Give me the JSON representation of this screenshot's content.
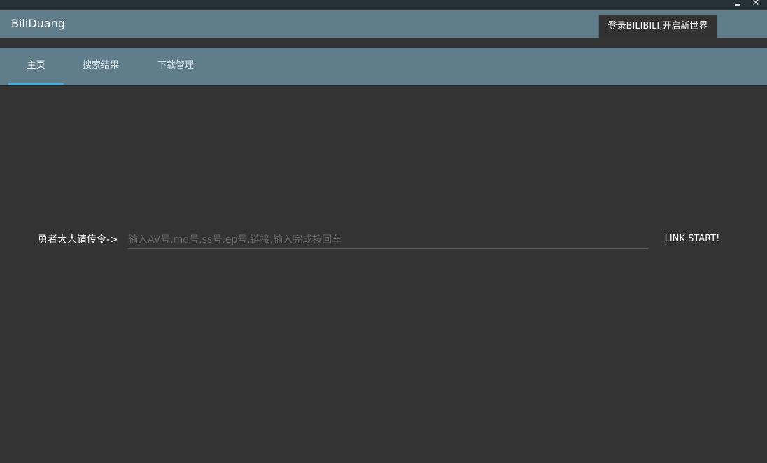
{
  "window": {
    "minimize_label": "",
    "close_label": "✕"
  },
  "app": {
    "title": "BiliDuang",
    "login_button": "登录BILIBILI,开启新世界"
  },
  "tabs": [
    {
      "label": "主页",
      "active": true
    },
    {
      "label": "搜索结果",
      "active": false
    },
    {
      "label": "下载管理",
      "active": false
    }
  ],
  "main": {
    "command_label": "勇者大人请传令->",
    "input_placeholder": "输入AV号,md号,ss号,ep号,链接,输入完成按回车",
    "input_value": "",
    "submit_label": "LINK START!"
  },
  "colors": {
    "titlebar": "#263238",
    "appbar": "#607d8b",
    "background": "#333333",
    "tab_indicator": "#29b6f6",
    "login_button_bg": "#323232"
  }
}
